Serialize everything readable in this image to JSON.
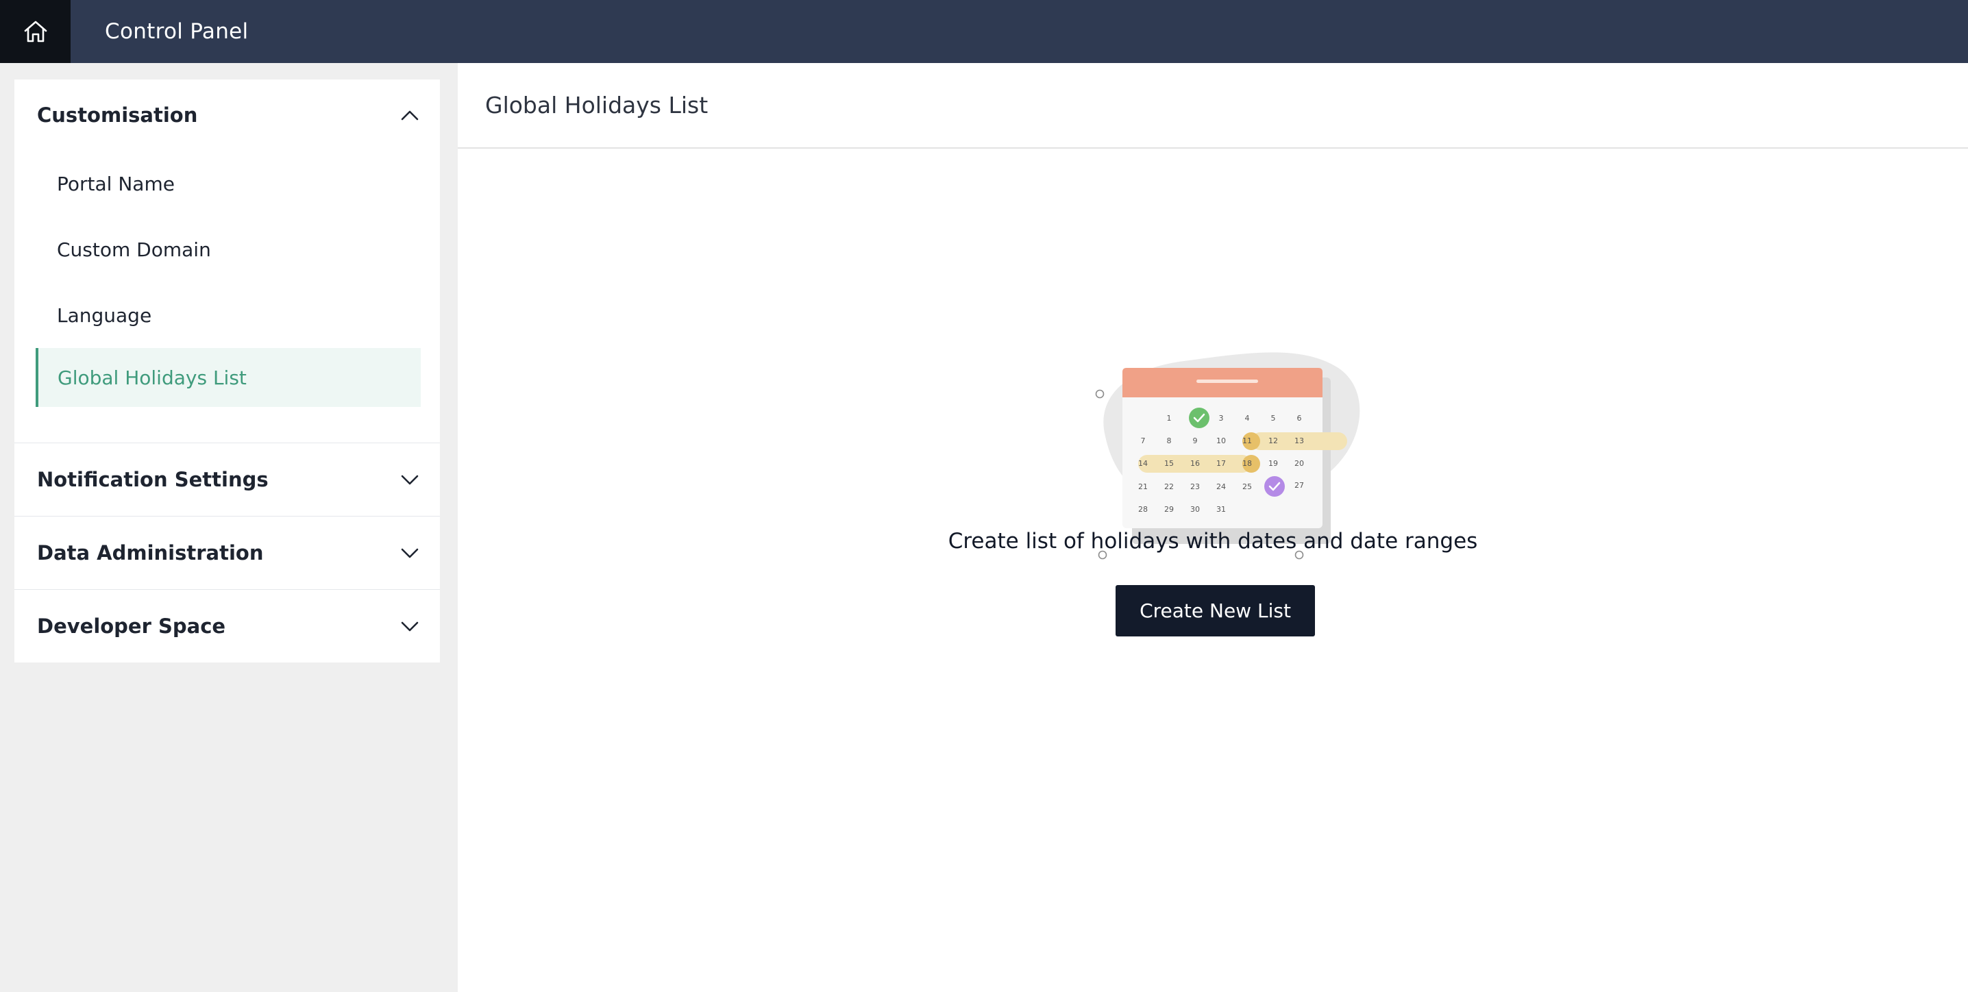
{
  "topbar": {
    "title": "Control Panel",
    "home_icon": "home-icon"
  },
  "sidebar": {
    "sections": [
      {
        "title": "Customisation",
        "expanded": true,
        "items": [
          {
            "label": "Portal Name",
            "active": false
          },
          {
            "label": "Custom Domain",
            "active": false
          },
          {
            "label": "Language",
            "active": false
          },
          {
            "label": "Global Holidays List",
            "active": true
          }
        ]
      },
      {
        "title": "Notification Settings",
        "expanded": false
      },
      {
        "title": "Data Administration",
        "expanded": false
      },
      {
        "title": "Developer Space",
        "expanded": false
      }
    ]
  },
  "main": {
    "title": "Global Holidays List",
    "empty_text": "Create list of holidays with dates and date ranges",
    "create_button": "Create New List"
  },
  "calendar": {
    "days": [
      "1",
      "3",
      "4",
      "5",
      "6",
      "7",
      "8",
      "9",
      "10",
      "11",
      "12",
      "13",
      "14",
      "15",
      "16",
      "17",
      "18",
      "19",
      "20",
      "21",
      "22",
      "23",
      "24",
      "25",
      "27",
      "28",
      "29",
      "30",
      "31"
    ]
  },
  "colors": {
    "topbar": "#2f3a52",
    "home_bg": "#0e1218",
    "accent": "#3f9b7c",
    "button": "#131b2b",
    "calendar_header": "#f0a187",
    "range": "#f3e3b5",
    "range_end": "#e7c068",
    "check_green": "#6cc06d",
    "check_purple": "#b48ae6"
  }
}
